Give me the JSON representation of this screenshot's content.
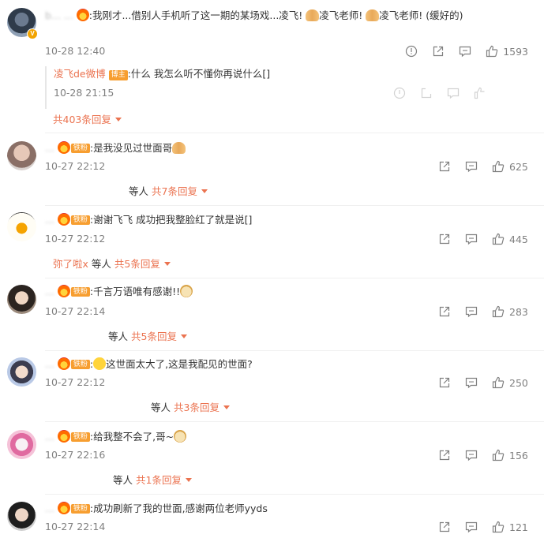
{
  "comments": [
    {
      "user": "b... ...",
      "has_v": true,
      "text_pre": ":我刚才...借别人手机听了这一期的某场戏...凌飞!",
      "text_mid1": "凌飞老师!",
      "text_mid2": "凌飞老师!",
      "text_post": "(缓好的)",
      "time": "10-28 12:40",
      "likes": "1593",
      "reply": {
        "user": "凌飞de微博",
        "badge": "博主",
        "text": ":什么 我怎么听不懂你再说什么[]",
        "time": "10-28 21:15"
      },
      "more_replies": "共403条回复"
    },
    {
      "user": "...",
      "badge": "铁粉",
      "text": ":是我没见过世面哥",
      "time": "10-27 22:12",
      "likes": "625",
      "reply_prefix": "等人",
      "more_replies": "共7条回复"
    },
    {
      "user": "...",
      "badge": "铁粉",
      "text": ":谢谢飞飞 成功把我整脸红了就是说[]",
      "time": "10-27 22:12",
      "likes": "445",
      "reply_user": "弥了啦x",
      "reply_prefix": "等人",
      "more_replies": "共5条回复"
    },
    {
      "user": "...",
      "badge": "铁粉",
      "text": ":千言万语唯有感谢!!",
      "time": "10-27 22:14",
      "likes": "283",
      "reply_prefix": "等人",
      "more_replies": "共5条回复"
    },
    {
      "user": "...",
      "badge": "铁粉",
      "text": "这世面太大了,这是我配见的世面?",
      "time": "10-27 22:12",
      "likes": "250",
      "reply_prefix": "等人",
      "more_replies": "共3条回复"
    },
    {
      "user": "...",
      "badge": "铁粉",
      "text": ":给我整不会了,哥~",
      "time": "10-27 22:16",
      "likes": "156",
      "reply_prefix": "等人",
      "more_replies": "共1条回复"
    },
    {
      "user": "...",
      "badge": "铁粉",
      "text": ":成功刷新了我的世面,感谢两位老师yyds",
      "time": "10-27 22:14",
      "likes": "121"
    }
  ],
  "icons": {
    "report": "report-icon",
    "share": "share-icon",
    "comment": "comment-icon",
    "like": "like-icon"
  },
  "colors": {
    "accent": "#eb7350",
    "badge": "#f79e30",
    "meta": "#808080"
  }
}
